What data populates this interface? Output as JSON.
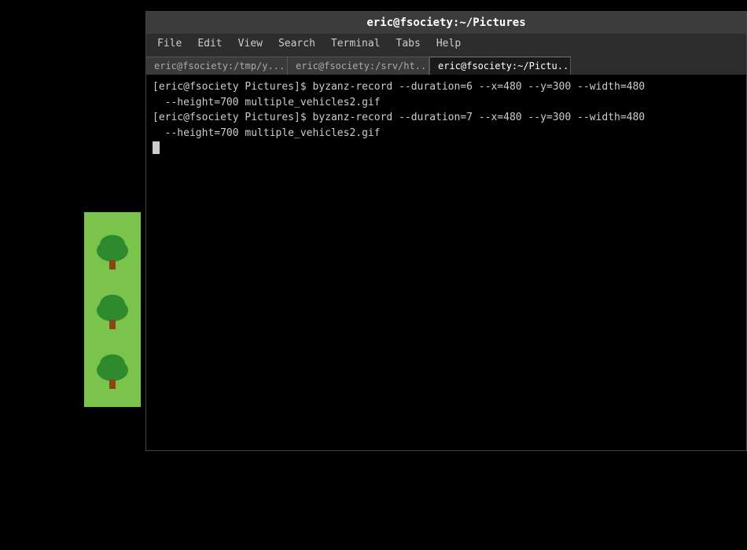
{
  "window": {
    "title": "eric@fsociety:~/Pictures",
    "background": "#000"
  },
  "menu": {
    "items": [
      "File",
      "Edit",
      "View",
      "Search",
      "Terminal",
      "Tabs",
      "Help"
    ]
  },
  "tabs": [
    {
      "label": "eric@fsociety:/tmp/y...",
      "active": false,
      "closeable": true
    },
    {
      "label": "eric@fsociety:/srv/ht...",
      "active": false,
      "closeable": true
    },
    {
      "label": "eric@fsociety:~/Pictu...",
      "active": true,
      "closeable": false
    }
  ],
  "terminal": {
    "lines": [
      "[eric@fsociety Pictures]$ byzanz-record --duration=6 --x=480 --y=300 --width=480 --height=700 multiple_vehicles2.gif",
      "[eric@fsociety Pictures]$ byzanz-record --duration=7 --x=480 --y=300 --width=480 --height=700 multiple_vehicles2.gif"
    ]
  }
}
